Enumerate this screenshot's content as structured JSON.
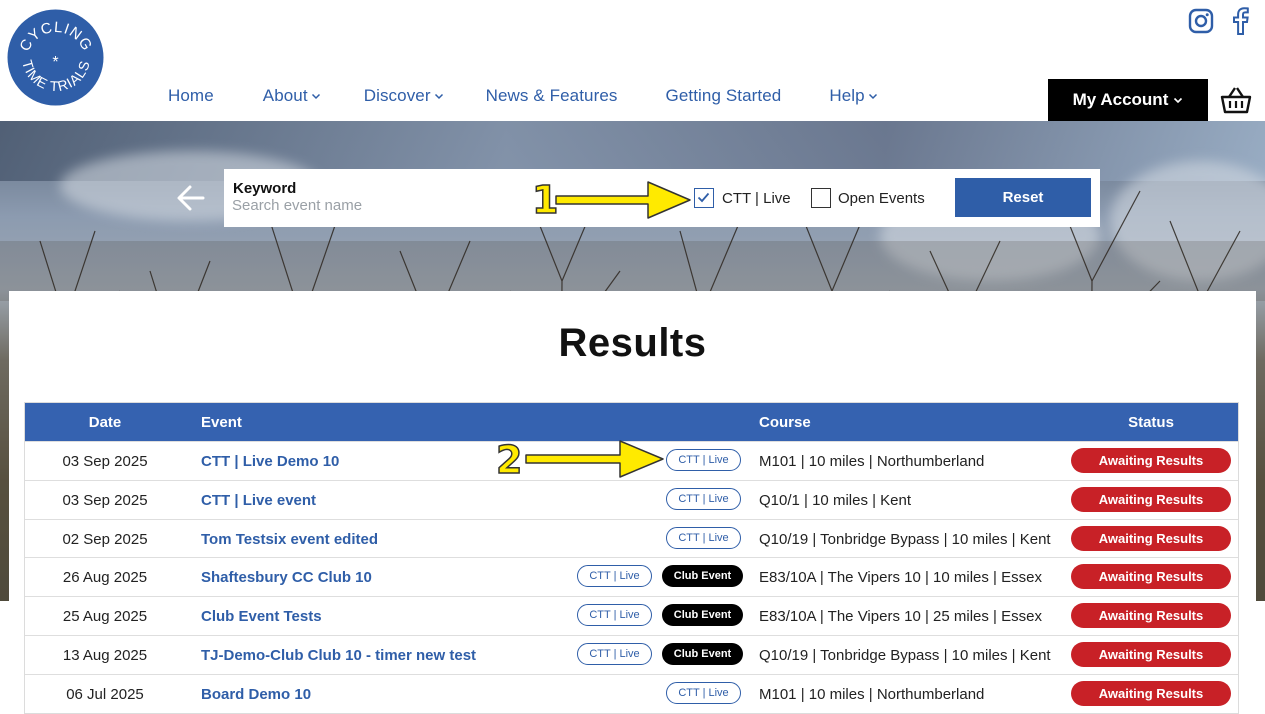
{
  "logo": {
    "line1": "CYCLING",
    "line2": "TIME TRIALS",
    "star": "*"
  },
  "social": [
    {
      "icon": "instagram-icon"
    },
    {
      "icon": "facebook-icon"
    }
  ],
  "nav": {
    "items": [
      {
        "label": "Home",
        "dropdown": false
      },
      {
        "label": "About",
        "dropdown": true
      },
      {
        "label": "Discover",
        "dropdown": true
      },
      {
        "label": "News & Features",
        "dropdown": false
      },
      {
        "label": "Getting Started",
        "dropdown": false
      },
      {
        "label": "Help",
        "dropdown": true
      }
    ],
    "account_label": "My Account"
  },
  "filter": {
    "keyword_label": "Keyword",
    "keyword_placeholder": "Search event name",
    "keyword_value": "",
    "ctt_live_label": "CTT | Live",
    "ctt_live_checked": true,
    "open_events_label": "Open Events",
    "open_events_checked": false,
    "reset_label": "Reset"
  },
  "annotations": {
    "one": "1",
    "two": "2"
  },
  "results": {
    "title": "Results",
    "columns": {
      "date": "Date",
      "event": "Event",
      "course": "Course",
      "status": "Status"
    },
    "rows": [
      {
        "date": "03 Sep 2025",
        "event": "CTT | Live Demo 10",
        "ctt_tag": "CTT | Live",
        "club_tag": "",
        "course": "M101 | 10 miles | Northumberland",
        "status": "Awaiting Results"
      },
      {
        "date": "03 Sep 2025",
        "event": "CTT | Live event",
        "ctt_tag": "CTT | Live",
        "club_tag": "",
        "course": "Q10/1 | 10 miles | Kent",
        "status": "Awaiting Results"
      },
      {
        "date": "02 Sep 2025",
        "event": "Tom Testsix event edited",
        "ctt_tag": "CTT | Live",
        "club_tag": "",
        "course": "Q10/19 | Tonbridge Bypass | 10 miles | Kent",
        "status": "Awaiting Results"
      },
      {
        "date": "26 Aug 2025",
        "event": "Shaftesbury CC Club 10",
        "ctt_tag": "CTT | Live",
        "club_tag": "Club Event",
        "course": "E83/10A | The Vipers 10 | 10 miles | Essex",
        "status": "Awaiting Results"
      },
      {
        "date": "25 Aug 2025",
        "event": "Club Event Tests",
        "ctt_tag": "CTT | Live",
        "club_tag": "Club Event",
        "course": "E83/10A | The Vipers 10 | 25 miles | Essex",
        "status": "Awaiting Results"
      },
      {
        "date": "13 Aug 2025",
        "event": "TJ-Demo-Club Club 10 - timer new test",
        "ctt_tag": "CTT | Live",
        "club_tag": "Club Event",
        "course": "Q10/19 | Tonbridge Bypass | 10 miles | Kent",
        "status": "Awaiting Results"
      },
      {
        "date": "06 Jul 2025",
        "event": "Board Demo 10",
        "ctt_tag": "CTT | Live",
        "club_tag": "",
        "course": "M101 | 10 miles | Northumberland",
        "status": "Awaiting Results"
      }
    ]
  },
  "colors": {
    "brand_blue": "#2f5ea8",
    "header_blue": "#3562b0",
    "status_red": "#c82127",
    "annotation_yellow": "#ffea00"
  }
}
